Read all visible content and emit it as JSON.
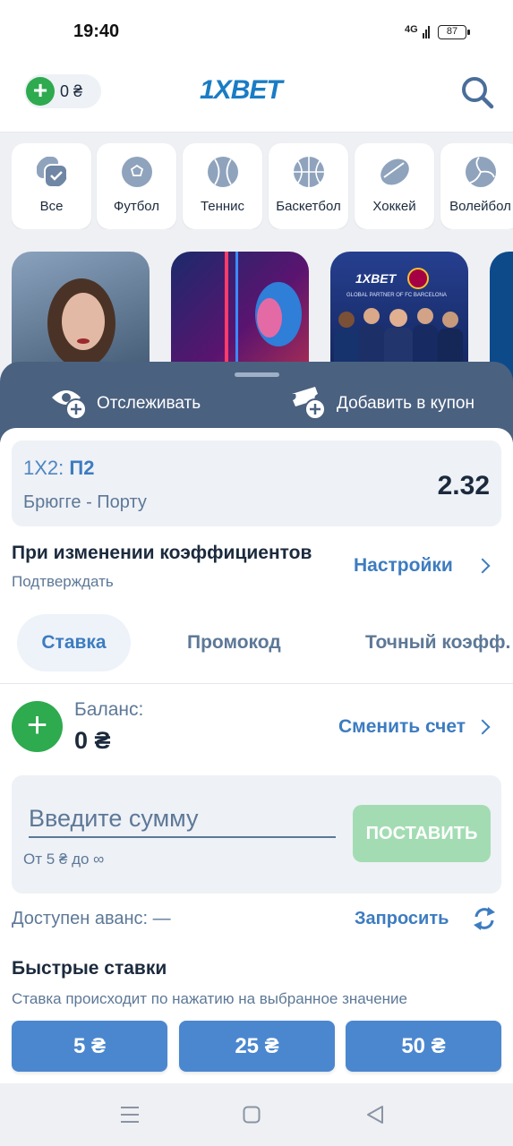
{
  "status_bar": {
    "time": "19:40",
    "network": "4G",
    "battery": "87"
  },
  "header": {
    "balance": "0 ₴",
    "logo": "1XBET"
  },
  "categories": [
    {
      "label": "Все",
      "icon": "all-sports-icon"
    },
    {
      "label": "Футбол",
      "icon": "football-icon"
    },
    {
      "label": "Теннис",
      "icon": "tennis-icon"
    },
    {
      "label": "Баскетбол",
      "icon": "basketball-icon"
    },
    {
      "label": "Хоккей",
      "icon": "hockey-icon"
    },
    {
      "label": "Волейбол",
      "icon": "volleyball-icon"
    }
  ],
  "banners": [
    {
      "name": "banner-woman-portrait",
      "color": "#6f8aa8"
    },
    {
      "name": "banner-neon-woman",
      "color": "#4a1a6e"
    },
    {
      "name": "banner-barcelona-partner",
      "color": "#1e3a8a",
      "logo_text": "1XBET",
      "caption": "GLOBAL PARTNER OF FC BARCELONA"
    },
    {
      "name": "banner-partial",
      "color": "#0d4a8a"
    }
  ],
  "sheet": {
    "track_label": "Отслеживать",
    "add_coupon_label": "Добавить в купон",
    "bet": {
      "type_prefix": "1X2:",
      "type_value": "П2",
      "match": "Брюгге - Порту",
      "coefficient": "2.32"
    },
    "coef_change_title": "При изменении коэффициентов",
    "coef_change_value": "Подтверждать",
    "settings_label": "Настройки",
    "tabs": [
      "Ставка",
      "Промокод",
      "Точный коэфф."
    ],
    "balance_label": "Баланс:",
    "balance_value": "0 ₴",
    "switch_account_label": "Сменить счет",
    "stake_placeholder": "Введите сумму",
    "stake_range": "От 5 ₴ до ∞",
    "place_bet_label": "ПОСТАВИТЬ",
    "advance_label": "Доступен аванс: —",
    "request_label": "Запросить",
    "quick_bets_title": "Быстрые ставки",
    "quick_bets_sub": "Ставка происходит по нажатию на выбранное значение",
    "quick_bets": [
      "5 ₴",
      "25 ₴",
      "50 ₴"
    ]
  },
  "colors": {
    "brand": "#1a7cc5",
    "accent": "#3d7cc0",
    "green": "#2eaa4f",
    "sheet_header": "#4a6180"
  }
}
